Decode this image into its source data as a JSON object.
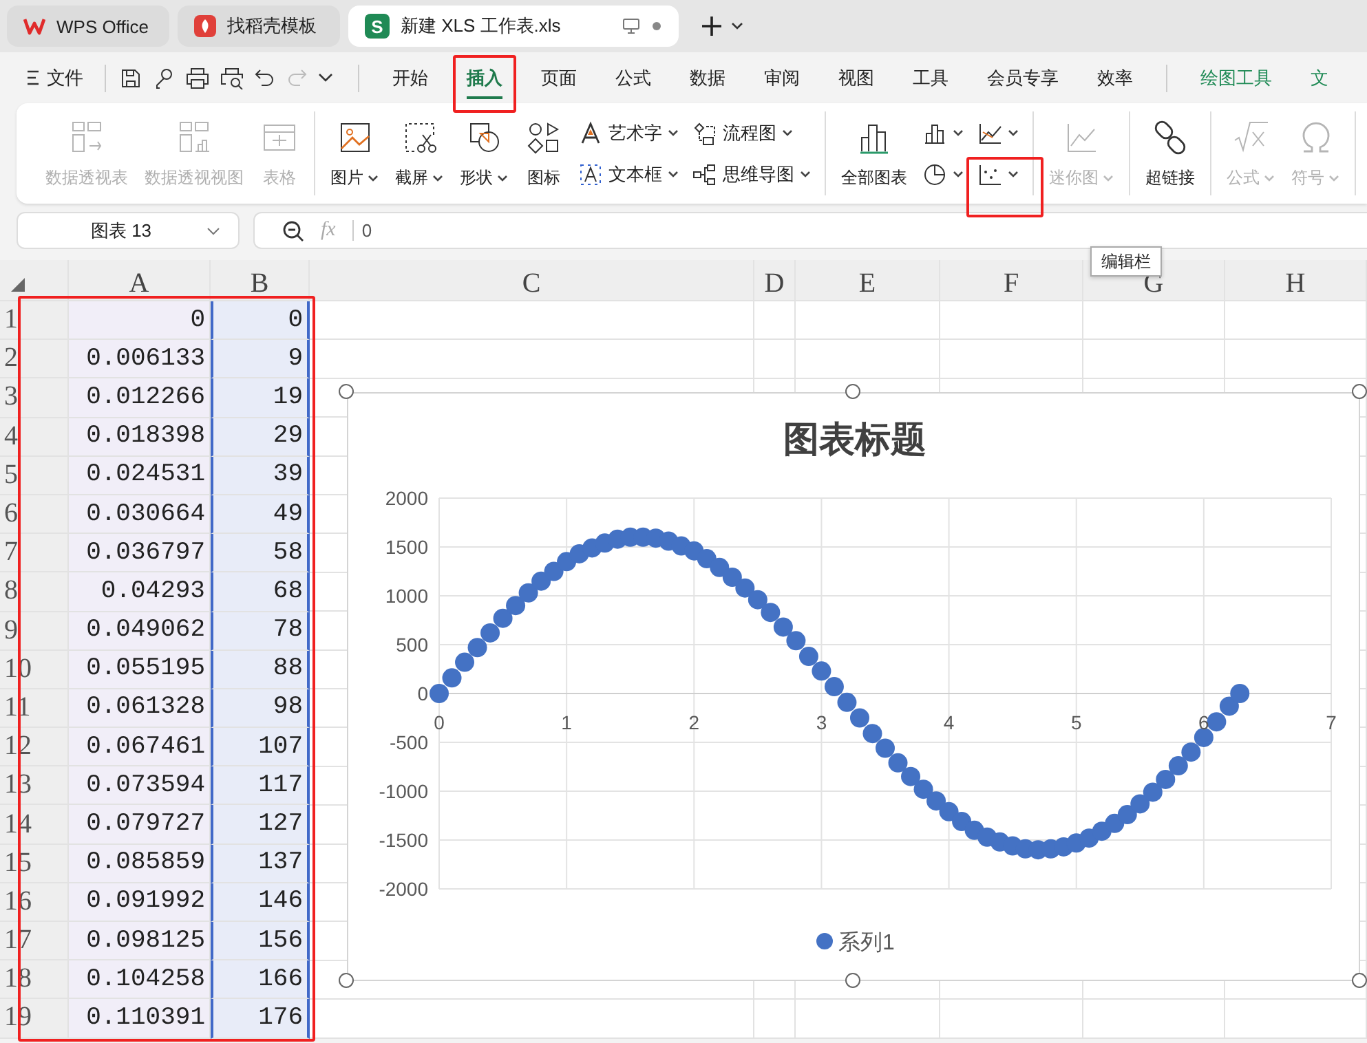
{
  "tabs": [
    {
      "label": "WPS Office",
      "selected": false
    },
    {
      "label": "找稻壳模板",
      "selected": false
    },
    {
      "label": "新建 XLS 工作表.xls",
      "selected": true,
      "badge": "S"
    }
  ],
  "menu": {
    "file": "文件",
    "tabs": [
      {
        "label": "开始",
        "selected": false,
        "highlighted": false,
        "kind": "normal"
      },
      {
        "label": "插入",
        "selected": true,
        "highlighted": true,
        "kind": "normal"
      },
      {
        "label": "页面",
        "selected": false,
        "highlighted": false,
        "kind": "normal"
      },
      {
        "label": "公式",
        "selected": false,
        "highlighted": false,
        "kind": "normal"
      },
      {
        "label": "数据",
        "selected": false,
        "highlighted": false,
        "kind": "normal"
      },
      {
        "label": "审阅",
        "selected": false,
        "highlighted": false,
        "kind": "normal"
      },
      {
        "label": "视图",
        "selected": false,
        "highlighted": false,
        "kind": "normal"
      },
      {
        "label": "工具",
        "selected": false,
        "highlighted": false,
        "kind": "normal"
      },
      {
        "label": "会员专享",
        "selected": false,
        "highlighted": false,
        "kind": "normal"
      },
      {
        "label": "效率",
        "selected": false,
        "highlighted": false,
        "kind": "normal"
      },
      {
        "label": "绘图工具",
        "selected": false,
        "highlighted": false,
        "kind": "contextual"
      },
      {
        "label": "文",
        "selected": false,
        "highlighted": false,
        "kind": "contextual"
      }
    ]
  },
  "ribbon": {
    "groups": [
      {
        "items": [
          {
            "kind": "large",
            "label": "数据透视表",
            "disabled": true,
            "dropdown": false
          },
          {
            "kind": "large",
            "label": "数据透视视图",
            "disabled": true,
            "dropdown": false
          },
          {
            "kind": "large",
            "label": "表格",
            "disabled": true,
            "dropdown": false
          }
        ]
      },
      {
        "items": [
          {
            "kind": "large",
            "label": "图片",
            "disabled": false,
            "dropdown": true
          },
          {
            "kind": "large",
            "label": "截屏",
            "disabled": false,
            "dropdown": true
          },
          {
            "kind": "large",
            "label": "形状",
            "disabled": false,
            "dropdown": true
          },
          {
            "kind": "large",
            "label": "图标",
            "disabled": false,
            "dropdown": false
          },
          {
            "kind": "stack",
            "items": [
              {
                "label": "艺术字",
                "dropdown": true,
                "highlighted": false
              },
              {
                "label": "文本框",
                "dropdown": true,
                "highlighted": false
              }
            ]
          },
          {
            "kind": "stack",
            "items": [
              {
                "label": "流程图",
                "dropdown": true,
                "highlighted": false
              },
              {
                "label": "思维导图",
                "dropdown": true,
                "highlighted": false
              }
            ]
          }
        ]
      },
      {
        "items": [
          {
            "kind": "large",
            "label": "全部图表",
            "disabled": false,
            "dropdown": false
          },
          {
            "kind": "stack",
            "items": [
              {
                "dropdown": true,
                "highlighted": false
              },
              {
                "dropdown": true,
                "highlighted": false
              }
            ]
          },
          {
            "kind": "stack",
            "items": [
              {
                "dropdown": true,
                "highlighted": false
              },
              {
                "dropdown": true,
                "highlighted": true
              }
            ]
          }
        ]
      },
      {
        "items": [
          {
            "kind": "large",
            "label": "迷你图",
            "disabled": true,
            "dropdown": true
          }
        ]
      },
      {
        "items": [
          {
            "kind": "large",
            "label": "超链接",
            "disabled": false,
            "dropdown": false
          }
        ]
      },
      {
        "items": [
          {
            "kind": "large",
            "label": "公式",
            "disabled": true,
            "dropdown": true
          },
          {
            "kind": "large",
            "label": "符号",
            "disabled": true,
            "dropdown": true
          }
        ]
      }
    ]
  },
  "formula_bar": {
    "name_box": "图表 13",
    "fx": "fx",
    "value": "0"
  },
  "tooltip": "编辑栏",
  "sheet": {
    "columns": [
      "A",
      "B",
      "C",
      "D",
      "E",
      "F",
      "G",
      "H"
    ],
    "selection_highlighted": true,
    "rows": [
      {
        "number": "1",
        "cells": [
          "0",
          "0"
        ]
      },
      {
        "number": "2",
        "cells": [
          "0.006133",
          "9"
        ]
      },
      {
        "number": "3",
        "cells": [
          "0.012266",
          "19"
        ]
      },
      {
        "number": "4",
        "cells": [
          "0.018398",
          "29"
        ]
      },
      {
        "number": "5",
        "cells": [
          "0.024531",
          "39"
        ]
      },
      {
        "number": "6",
        "cells": [
          "0.030664",
          "49"
        ]
      },
      {
        "number": "7",
        "cells": [
          "0.036797",
          "58"
        ]
      },
      {
        "number": "8",
        "cells": [
          "0.04293",
          "68"
        ]
      },
      {
        "number": "9",
        "cells": [
          "0.049062",
          "78"
        ]
      },
      {
        "number": "10",
        "cells": [
          "0.055195",
          "88"
        ]
      },
      {
        "number": "11",
        "cells": [
          "0.061328",
          "98"
        ]
      },
      {
        "number": "12",
        "cells": [
          "0.067461",
          "107"
        ]
      },
      {
        "number": "13",
        "cells": [
          "0.073594",
          "117"
        ]
      },
      {
        "number": "14",
        "cells": [
          "0.079727",
          "127"
        ]
      },
      {
        "number": "15",
        "cells": [
          "0.085859",
          "137"
        ]
      },
      {
        "number": "16",
        "cells": [
          "0.091992",
          "146"
        ]
      },
      {
        "number": "17",
        "cells": [
          "0.098125",
          "156"
        ]
      },
      {
        "number": "18",
        "cells": [
          "0.104258",
          "166"
        ]
      },
      {
        "number": "19",
        "cells": [
          "0.110391",
          "176"
        ]
      }
    ]
  },
  "chart": {
    "selected": true,
    "chart_data": {
      "type": "scatter",
      "title": "图表标题",
      "x": [
        0,
        0.1,
        0.2,
        0.3,
        0.4,
        0.5,
        0.6,
        0.7,
        0.8,
        0.9,
        1,
        1.1,
        1.2,
        1.3,
        1.4,
        1.5,
        1.6,
        1.7,
        1.8,
        1.9,
        2,
        2.1,
        2.2,
        2.3,
        2.4,
        2.5,
        2.6,
        2.7,
        2.8,
        2.9,
        3,
        3.1,
        3.2,
        3.3,
        3.4,
        3.5,
        3.6,
        3.7,
        3.8,
        3.9,
        4,
        4.1,
        4.2,
        4.3,
        4.4,
        4.5,
        4.6,
        4.7,
        4.8,
        4.9,
        5,
        5.1,
        5.2,
        5.3,
        5.4,
        5.5,
        5.6,
        5.7,
        5.8,
        5.9,
        6,
        6.1,
        6.2,
        6.283
      ],
      "series": [
        {
          "name": "系列1",
          "color": "#4472c4",
          "values": [
            0,
            160,
            320,
            470,
            620,
            770,
            900,
            1030,
            1150,
            1250,
            1350,
            1430,
            1490,
            1540,
            1580,
            1600,
            1600,
            1590,
            1560,
            1510,
            1460,
            1380,
            1290,
            1190,
            1080,
            960,
            830,
            680,
            540,
            380,
            230,
            70,
            -90,
            -250,
            -410,
            -560,
            -710,
            -850,
            -980,
            -1100,
            -1210,
            -1310,
            -1400,
            -1470,
            -1520,
            -1560,
            -1590,
            -1600,
            -1590,
            -1570,
            -1530,
            -1480,
            -1410,
            -1330,
            -1240,
            -1130,
            -1010,
            -880,
            -740,
            -600,
            -450,
            -290,
            -130,
            0
          ]
        }
      ],
      "grid": true,
      "xlim": [
        0,
        7
      ],
      "ylim": [
        -2000,
        2000
      ],
      "xticks": [
        0,
        1,
        2,
        3,
        4,
        5,
        6,
        7
      ],
      "yticks": [
        -2000,
        -1500,
        -1000,
        -500,
        0,
        500,
        1000,
        1500,
        2000
      ]
    }
  }
}
